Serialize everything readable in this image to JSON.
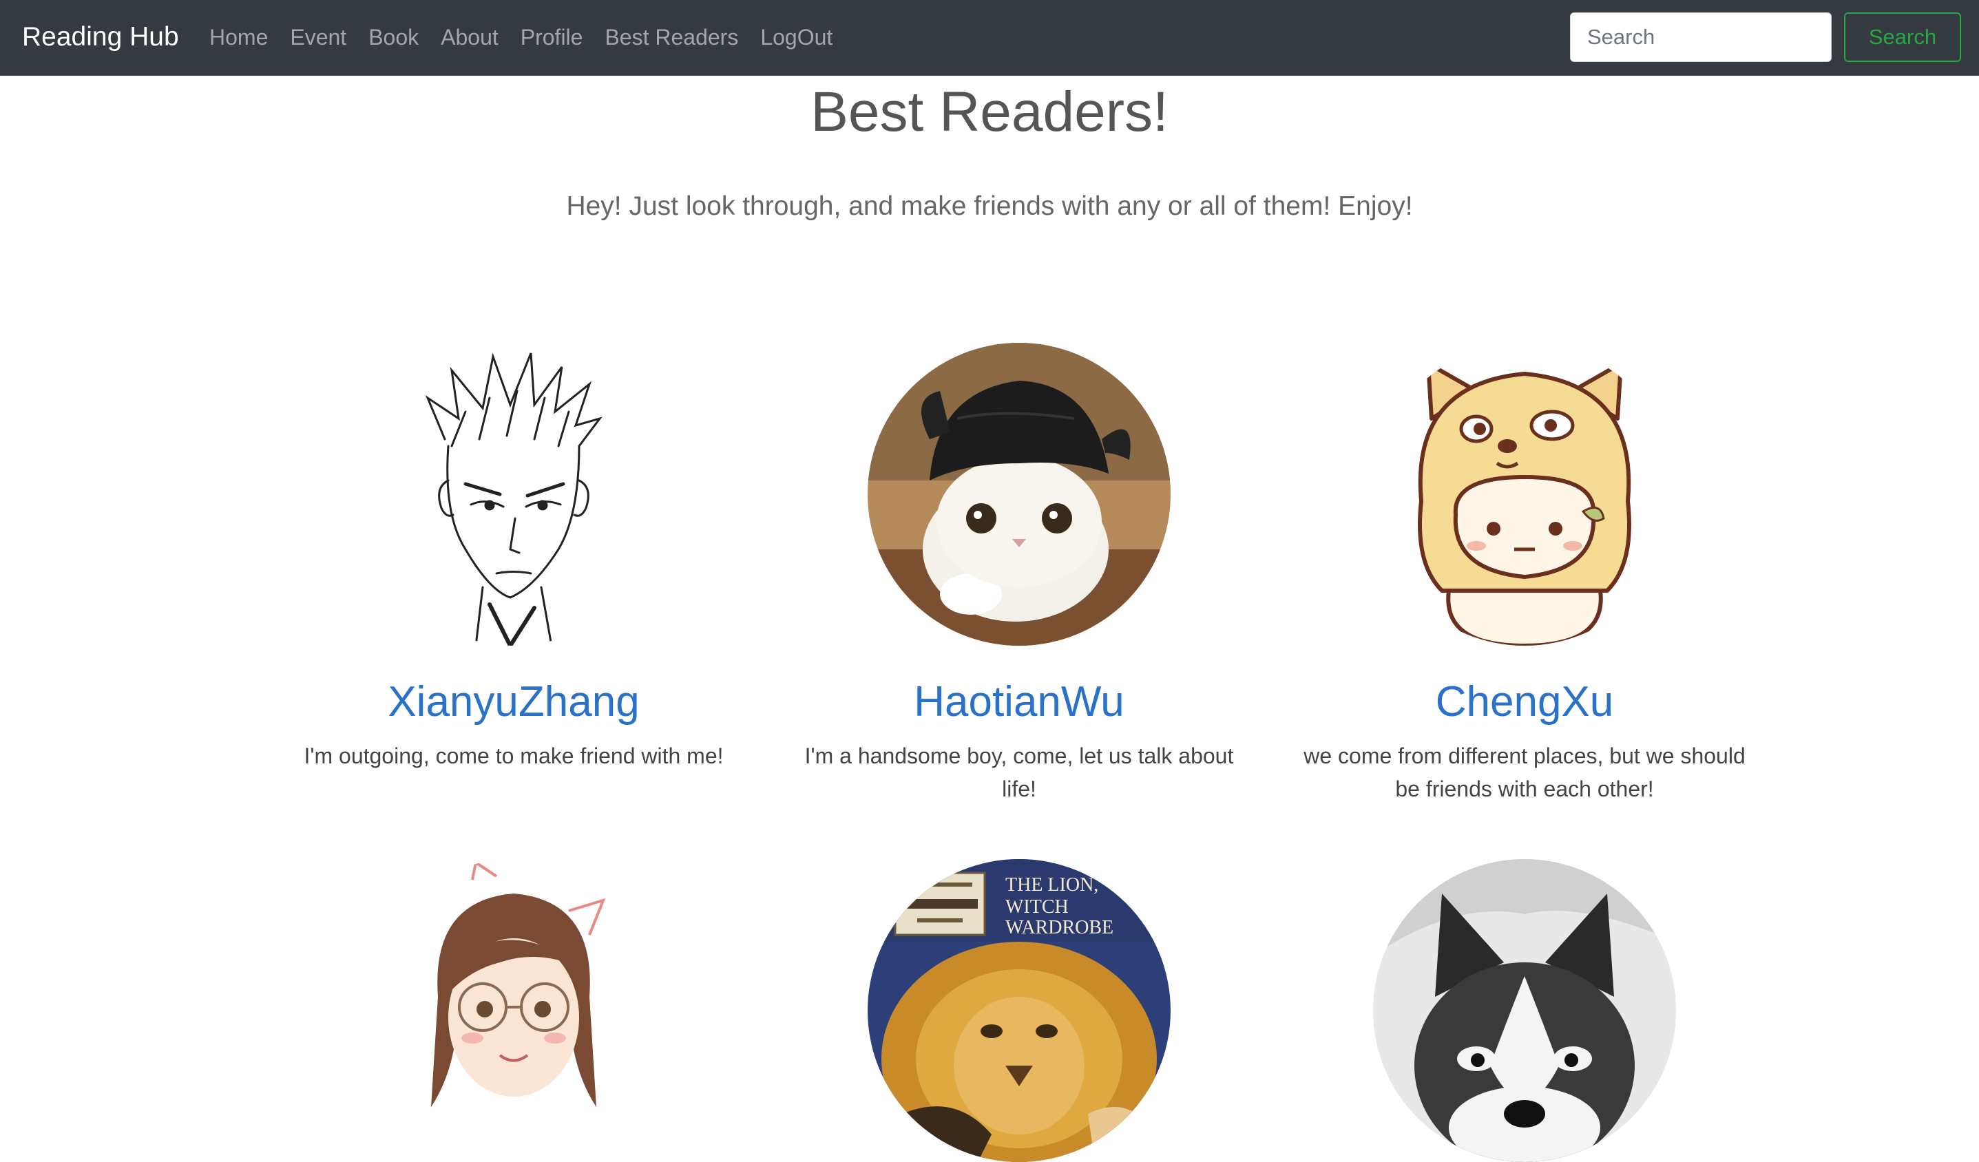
{
  "navbar": {
    "brand": "Reading Hub",
    "links": [
      "Home",
      "Event",
      "Book",
      "About",
      "Profile",
      "Best Readers",
      "LogOut"
    ],
    "search_placeholder": "Search",
    "search_button": "Search"
  },
  "page": {
    "title": "Best Readers!",
    "subtitle": "Hey! Just look through, and make friends with any or all of them! Enjoy!"
  },
  "readers": [
    {
      "name": "XianyuZhang",
      "bio": "I'm outgoing, come to make friend with me!",
      "avatar": "anime-boy-sketch-avatar"
    },
    {
      "name": "HaotianWu",
      "bio": "I'm a handsome boy, come, let us talk about life!",
      "avatar": "cat-in-hat-avatar"
    },
    {
      "name": "ChengXu",
      "bio": "we come from different places, but we should be friends with each other!",
      "avatar": "shiba-hood-cartoon-avatar"
    },
    {
      "avatar": "anime-girl-glasses-avatar"
    },
    {
      "avatar": "narnia-book-cover-avatar",
      "cover_text": [
        "THE LION,",
        "WITCH",
        "WARDROBE"
      ]
    },
    {
      "avatar": "husky-puppy-avatar"
    }
  ],
  "colors": {
    "navbar_bg": "#343a40",
    "link_blue": "#2a72c9",
    "search_green": "#28a745"
  }
}
